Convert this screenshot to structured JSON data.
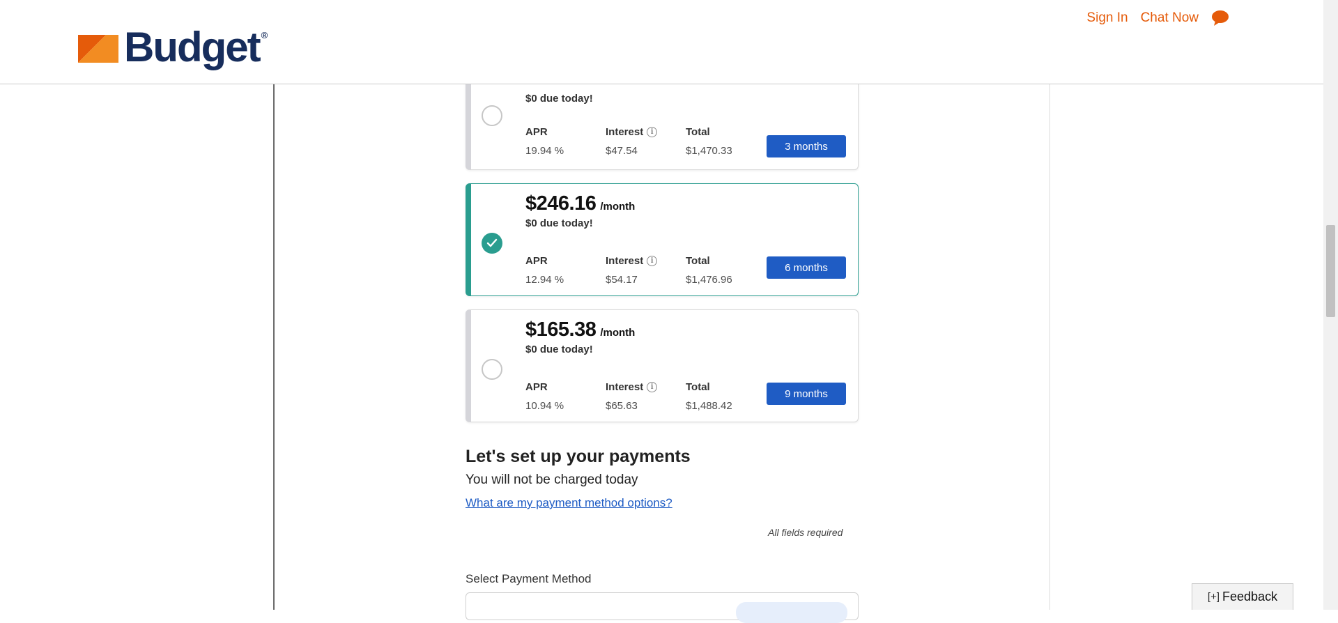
{
  "header": {
    "logo_text": "Budget",
    "logo_reg": "®",
    "sign_in": "Sign In",
    "chat_now": "Chat Now",
    "accent_color": "#e55b0a",
    "brand_color": "#172d5c"
  },
  "plans": [
    {
      "price": "",
      "per": "",
      "due": "$0 due today!",
      "apr_label": "APR",
      "apr": "19.94 %",
      "interest_label": "Interest",
      "interest": "$47.54",
      "total_label": "Total",
      "total": "$1,470.33",
      "term": "3 months",
      "selected": false
    },
    {
      "price": "$246.16",
      "per": "/month",
      "due": "$0 due today!",
      "apr_label": "APR",
      "apr": "12.94 %",
      "interest_label": "Interest",
      "interest": "$54.17",
      "total_label": "Total",
      "total": "$1,476.96",
      "term": "6 months",
      "selected": true
    },
    {
      "price": "$165.38",
      "per": "/month",
      "due": "$0 due today!",
      "apr_label": "APR",
      "apr": "10.94 %",
      "interest_label": "Interest",
      "interest": "$65.63",
      "total_label": "Total",
      "total": "$1,488.42",
      "term": "9 months",
      "selected": false
    }
  ],
  "payments": {
    "heading": "Let's set up your payments",
    "subheading": "You will not be charged today",
    "link": "What are my payment method options?",
    "required_note": "All fields required",
    "select_label": "Select Payment Method"
  },
  "feedback": {
    "plus": "[+]",
    "label": "Feedback"
  },
  "icons": {
    "chat": "chat-bubble-icon",
    "check": "checkmark-icon",
    "info": "info-icon"
  }
}
